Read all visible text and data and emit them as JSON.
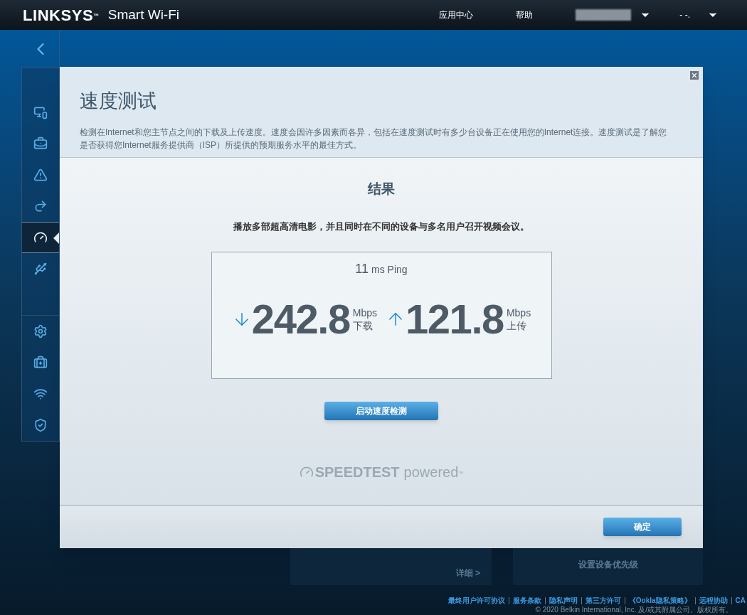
{
  "header": {
    "logo": "LINKSYS",
    "logo_mark": "™",
    "product": "Smart Wi-Fi",
    "menu": [
      {
        "label": "应用中心"
      },
      {
        "label": "帮助"
      }
    ],
    "account_menu": {
      "label": "- -."
    }
  },
  "sidebar": {
    "items": [
      {
        "selected": false
      },
      {
        "selected": false
      },
      {
        "selected": false
      },
      {
        "selected": false
      },
      {
        "selected": true
      },
      {
        "selected": false
      },
      {
        "selected": false
      },
      {
        "selected": false
      },
      {
        "selected": false
      },
      {
        "selected": false
      }
    ]
  },
  "dialog": {
    "title": "速度测试",
    "description": "检测在Internet和您主节点之间的下载及上传速度。速度会因许多因素而各异，包括在速度测试时有多少台设备正在使用您的Internet连接。速度测试是了解您是否获得您Internet服务提供商（ISP）所提供的预期服务水平的最佳方式。",
    "result_heading": "结果",
    "result_text": "播放多部超高清电影，并且同时在不同的设备与多名用户召开视频会议。",
    "ping": {
      "value": "11",
      "unit": "ms Ping"
    },
    "download": {
      "value": "242.8",
      "unit": "Mbps",
      "label": "下载"
    },
    "upload": {
      "value": "121.8",
      "unit": "Mbps",
      "label": "上传"
    },
    "start_button": "启动速度检测",
    "brand": {
      "name": "SPEEDTEST",
      "suffix": "powered",
      "mark": "™"
    },
    "ok_button": "确定"
  },
  "background_cards": [
    {
      "text": "详细 >"
    },
    {
      "text": "设置设备优先级"
    }
  ],
  "footer": {
    "links": [
      "最终用户许可协议",
      "服务条款",
      "隐私声明",
      "第三方许可",
      "《Ookla隐私策略》",
      "远程协助",
      "CA"
    ],
    "copyright": "© 2020 Belkin International, Inc. 及/或其附属公司。版权所有。"
  }
}
